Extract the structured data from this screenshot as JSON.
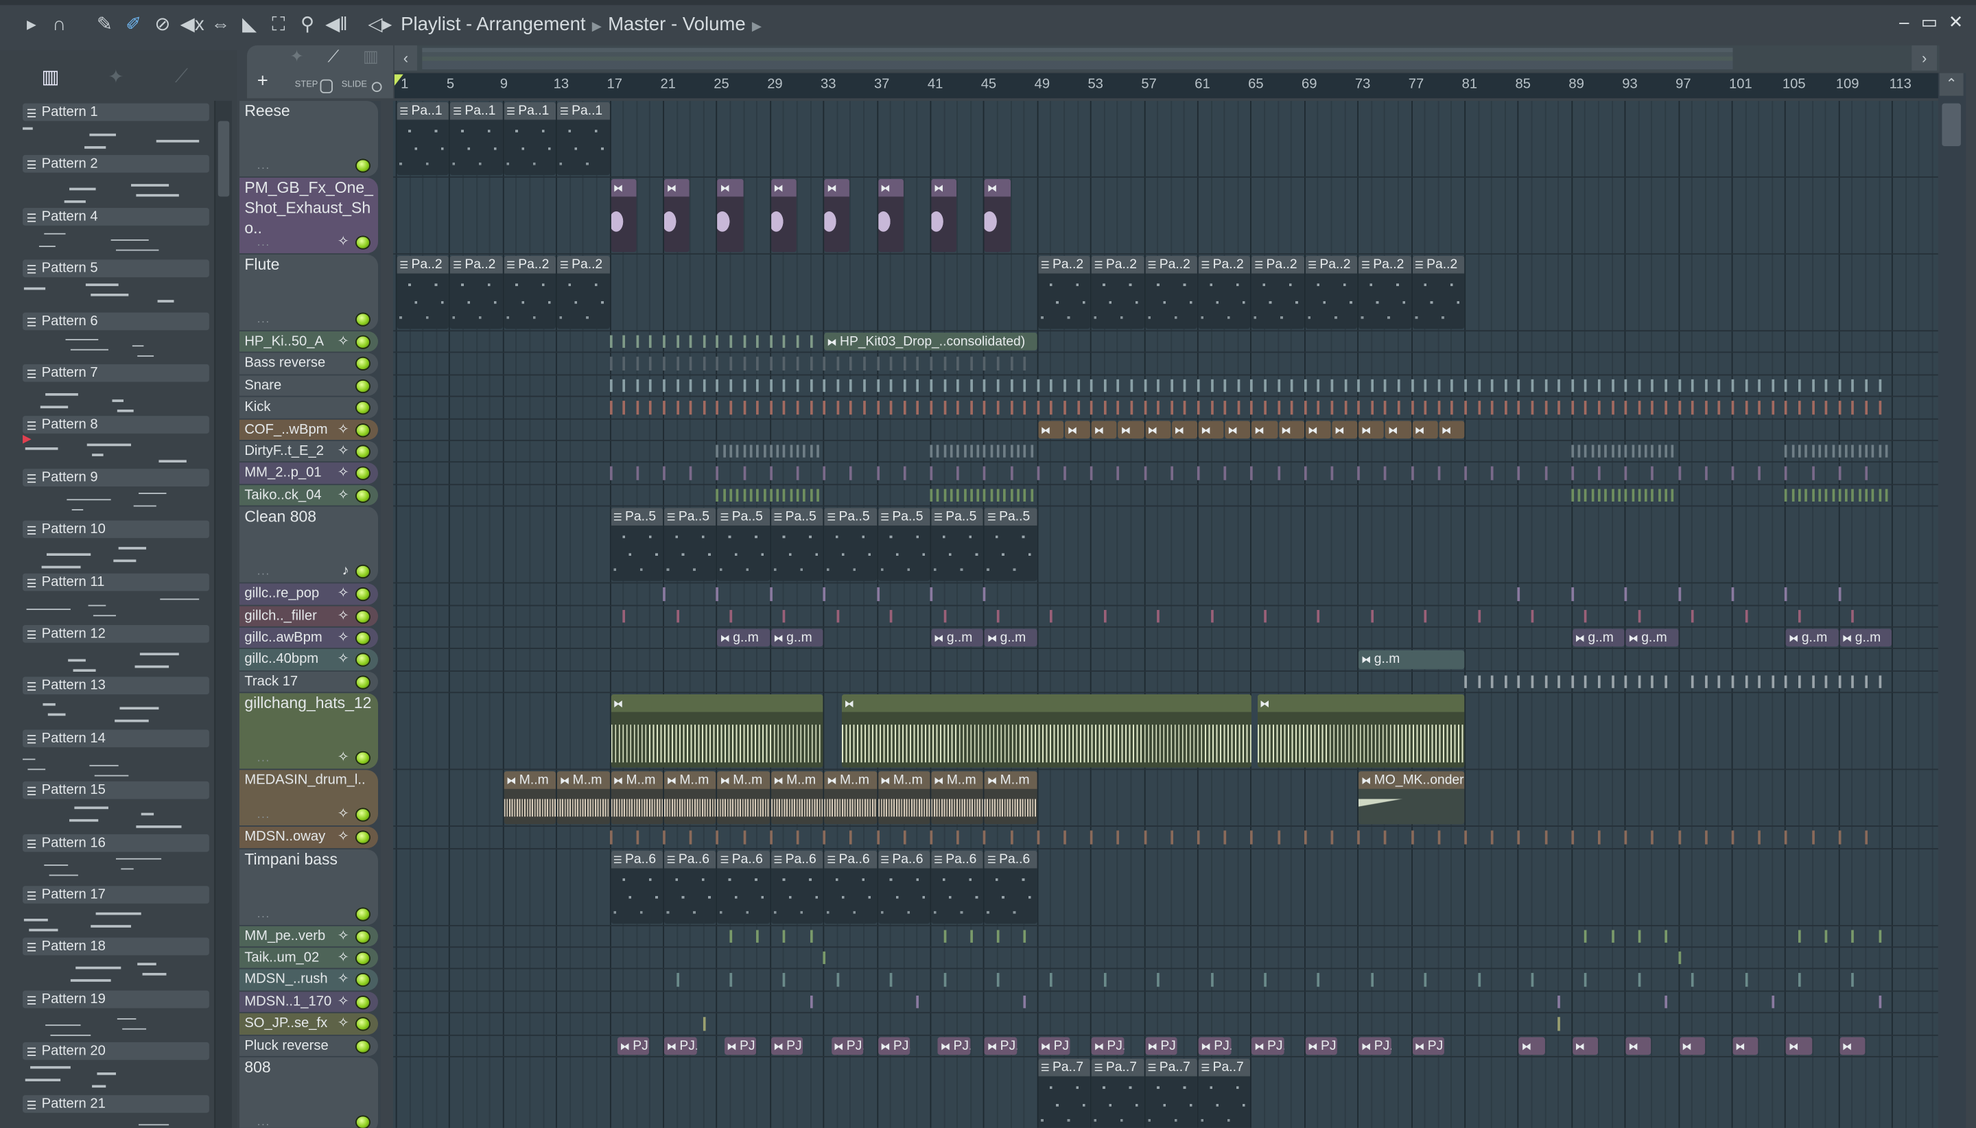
{
  "window": {
    "title": "Playlist - Arrangement",
    "breadcrumb": [
      "Playlist - Arrangement",
      "Master - Volume"
    ],
    "controls": {
      "minimize": "–",
      "maximize": "▭",
      "close": "✕"
    }
  },
  "toolbar": {
    "icons": [
      "play-arrow-icon",
      "magnet-icon",
      "pencil-icon",
      "paint-brush-icon",
      "delete-icon",
      "mute-icon",
      "slip-icon",
      "slice-icon",
      "select-icon",
      "zoom-icon",
      "playback-icon",
      "speaker-icon"
    ]
  },
  "playlist_tabs": {
    "add": "+",
    "step": "STEP",
    "slide": "SLIDE"
  },
  "ruler": {
    "bars": [
      1,
      5,
      9,
      13,
      17,
      21,
      25,
      29,
      33,
      37,
      41,
      45,
      49,
      53,
      57,
      61,
      65,
      69,
      73,
      77,
      81,
      85,
      89,
      93,
      97,
      101,
      105,
      109,
      113
    ]
  },
  "patterns": [
    "Pattern 1",
    "Pattern 2",
    "Pattern 4",
    "Pattern 5",
    "Pattern 6",
    "Pattern 7",
    "Pattern 8",
    "Pattern 9",
    "Pattern 10",
    "Pattern 11",
    "Pattern 12",
    "Pattern 13",
    "Pattern 14",
    "Pattern 15",
    "Pattern 16",
    "Pattern 17",
    "Pattern 18",
    "Pattern 19",
    "Pattern 20",
    "Pattern 21"
  ],
  "colors": {
    "default": "#4a535a",
    "purple": "#5e5270",
    "green": "#4e6458",
    "brown": "#6b5a47",
    "violet": "#534f68",
    "olive": "#596a4c",
    "rose": "#5f4a55",
    "teal": "#4a6062",
    "tan": "#6a5e4a",
    "khaki": "#5e6348"
  },
  "tracks": [
    {
      "name": "Reese",
      "size": "tall",
      "color": "default",
      "icon": "",
      "clips": [
        {
          "s": 1,
          "l": 4,
          "t": "Pa..1",
          "k": "p"
        },
        {
          "s": 5,
          "l": 4,
          "t": "Pa..1",
          "k": "p"
        },
        {
          "s": 9,
          "l": 4,
          "t": "Pa..1",
          "k": "p"
        },
        {
          "s": 13,
          "l": 4,
          "t": "Pa..1",
          "k": "p"
        }
      ]
    },
    {
      "name": "PM_GB_Fx_One_Shot_Exhaust_Sho..",
      "size": "tall",
      "color": "purple",
      "icon": "wave",
      "clips": [
        {
          "s": 17,
          "l": 2,
          "t": "",
          "k": "a"
        },
        {
          "s": 21,
          "l": 2,
          "t": "",
          "k": "a"
        },
        {
          "s": 25,
          "l": 2,
          "t": "",
          "k": "a"
        },
        {
          "s": 29,
          "l": 2,
          "t": "",
          "k": "a"
        },
        {
          "s": 33,
          "l": 2,
          "t": "",
          "k": "a"
        },
        {
          "s": 37,
          "l": 2,
          "t": "",
          "k": "a"
        },
        {
          "s": 41,
          "l": 2,
          "t": "",
          "k": "a"
        },
        {
          "s": 45,
          "l": 2,
          "t": "",
          "k": "a"
        }
      ]
    },
    {
      "name": "Flute",
      "size": "tall",
      "color": "default",
      "icon": "",
      "clips": [
        {
          "s": 1,
          "l": 4,
          "t": "Pa..2",
          "k": "p"
        },
        {
          "s": 5,
          "l": 4,
          "t": "Pa..2",
          "k": "p"
        },
        {
          "s": 9,
          "l": 4,
          "t": "Pa..2",
          "k": "p"
        },
        {
          "s": 13,
          "l": 4,
          "t": "Pa..2",
          "k": "p"
        },
        {
          "s": 49,
          "l": 4,
          "t": "Pa..2",
          "k": "p"
        },
        {
          "s": 53,
          "l": 4,
          "t": "Pa..2",
          "k": "p"
        },
        {
          "s": 57,
          "l": 4,
          "t": "Pa..2",
          "k": "p"
        },
        {
          "s": 61,
          "l": 4,
          "t": "Pa..2",
          "k": "p"
        },
        {
          "s": 65,
          "l": 4,
          "t": "Pa..2",
          "k": "p"
        },
        {
          "s": 69,
          "l": 4,
          "t": "Pa..2",
          "k": "p"
        },
        {
          "s": 73,
          "l": 4,
          "t": "Pa..2",
          "k": "p"
        },
        {
          "s": 77,
          "l": 4,
          "t": "Pa..2",
          "k": "p"
        }
      ]
    },
    {
      "name": "HP_Ki..50_A",
      "size": "small",
      "color": "green",
      "icon": "wave",
      "ticks": [
        [
          17,
          33,
          1,
          "#7f9a88"
        ]
      ],
      "clips": [
        {
          "s": 33,
          "l": 16,
          "t": "HP_Kit03_Drop_..consolidated)",
          "k": "a"
        }
      ]
    },
    {
      "name": "Bass reverse",
      "size": "small",
      "color": "default",
      "icon": "",
      "ticks": [
        [
          17,
          49,
          1,
          "#56626a"
        ]
      ]
    },
    {
      "name": "Snare",
      "size": "small",
      "color": "default",
      "icon": "",
      "ticks": [
        [
          17,
          113,
          1,
          "#8aa0a6"
        ]
      ]
    },
    {
      "name": "Kick",
      "size": "small",
      "color": "default",
      "icon": "",
      "ticks": [
        [
          17,
          113,
          1,
          "#a26a60"
        ]
      ]
    },
    {
      "name": "COF_..wBpm",
      "size": "small",
      "color": "brown",
      "icon": "wave",
      "clips": [
        {
          "s": 49,
          "l": 2,
          "t": "",
          "k": "a"
        },
        {
          "s": 51,
          "l": 2,
          "t": "",
          "k": "a"
        },
        {
          "s": 53,
          "l": 2,
          "t": "",
          "k": "a"
        },
        {
          "s": 55,
          "l": 2,
          "t": "",
          "k": "a"
        },
        {
          "s": 57,
          "l": 2,
          "t": "",
          "k": "a"
        },
        {
          "s": 59,
          "l": 2,
          "t": "",
          "k": "a"
        },
        {
          "s": 61,
          "l": 2,
          "t": "",
          "k": "a"
        },
        {
          "s": 63,
          "l": 2,
          "t": "",
          "k": "a"
        },
        {
          "s": 65,
          "l": 2,
          "t": "",
          "k": "a"
        },
        {
          "s": 67,
          "l": 2,
          "t": "",
          "k": "a"
        },
        {
          "s": 69,
          "l": 2,
          "t": "",
          "k": "a"
        },
        {
          "s": 71,
          "l": 2,
          "t": "",
          "k": "a"
        },
        {
          "s": 73,
          "l": 2,
          "t": "",
          "k": "a"
        },
        {
          "s": 75,
          "l": 2,
          "t": "",
          "k": "a"
        },
        {
          "s": 77,
          "l": 2,
          "t": "",
          "k": "a"
        },
        {
          "s": 79,
          "l": 2,
          "t": "",
          "k": "a"
        }
      ]
    },
    {
      "name": "DirtyF..t_E_2",
      "size": "small",
      "color": "default",
      "icon": "wave",
      "ticks": [
        [
          25,
          33,
          0.5,
          "#6f7e86"
        ],
        [
          41,
          49,
          0.5,
          "#6f7e86"
        ],
        [
          89,
          97,
          0.5,
          "#6f7e86"
        ],
        [
          105,
          113,
          0.5,
          "#6f7e86"
        ]
      ]
    },
    {
      "name": "MM_2..p_01",
      "size": "small",
      "color": "violet",
      "icon": "wave",
      "ticks": [
        [
          17,
          113,
          2,
          "#7a6a8a"
        ]
      ]
    },
    {
      "name": "Taiko..ck_04",
      "size": "small",
      "color": "green",
      "icon": "wave",
      "ticks": [
        [
          25,
          33,
          0.5,
          "#6f8f5f"
        ],
        [
          41,
          49,
          0.5,
          "#6f8f5f"
        ],
        [
          89,
          97,
          0.5,
          "#6f8f5f"
        ],
        [
          105,
          113,
          0.5,
          "#6f8f5f"
        ]
      ]
    },
    {
      "name": "Clean 808",
      "size": "tall",
      "color": "default",
      "icon": "note",
      "clips": [
        {
          "s": 17,
          "l": 4,
          "t": "Pa..5",
          "k": "p"
        },
        {
          "s": 21,
          "l": 4,
          "t": "Pa..5",
          "k": "p"
        },
        {
          "s": 25,
          "l": 4,
          "t": "Pa..5",
          "k": "p"
        },
        {
          "s": 29,
          "l": 4,
          "t": "Pa..5",
          "k": "p"
        },
        {
          "s": 33,
          "l": 4,
          "t": "Pa..5",
          "k": "p"
        },
        {
          "s": 37,
          "l": 4,
          "t": "Pa..5",
          "k": "p"
        },
        {
          "s": 41,
          "l": 4,
          "t": "Pa..5",
          "k": "p"
        },
        {
          "s": 45,
          "l": 4,
          "t": "Pa..5",
          "k": "p"
        }
      ]
    },
    {
      "name": "gillc..re_pop",
      "size": "small",
      "color": "violet",
      "icon": "wave",
      "ticks": [
        [
          21,
          49,
          4,
          "#8a7aa0"
        ],
        [
          85,
          113,
          4,
          "#8a7aa0"
        ]
      ]
    },
    {
      "name": "gillch.._filler",
      "size": "small",
      "color": "rose",
      "icon": "wave",
      "ticks": [
        [
          18,
          113,
          4,
          "#9a6078"
        ]
      ]
    },
    {
      "name": "gillc..awBpm",
      "size": "small",
      "color": "violet",
      "icon": "wave",
      "clips": [
        {
          "s": 25,
          "l": 4,
          "t": "g..m",
          "k": "a"
        },
        {
          "s": 29,
          "l": 4,
          "t": "g..m",
          "k": "a"
        },
        {
          "s": 41,
          "l": 4,
          "t": "g..m",
          "k": "a"
        },
        {
          "s": 45,
          "l": 4,
          "t": "g..m",
          "k": "a"
        },
        {
          "s": 89,
          "l": 4,
          "t": "g..m",
          "k": "a"
        },
        {
          "s": 93,
          "l": 4,
          "t": "g..m",
          "k": "a"
        },
        {
          "s": 105,
          "l": 4,
          "t": "g..m",
          "k": "a"
        },
        {
          "s": 109,
          "l": 4,
          "t": "g..m",
          "k": "a"
        }
      ]
    },
    {
      "name": "gillc..40bpm",
      "size": "small",
      "color": "teal",
      "icon": "wave",
      "clips": [
        {
          "s": 73,
          "l": 8,
          "t": "g..m",
          "k": "a"
        }
      ]
    },
    {
      "name": "Track 17",
      "size": "small",
      "color": "default",
      "icon": "",
      "ticks": [
        [
          81,
          97,
          1,
          "#9aa4aa"
        ],
        [
          98,
          113,
          1,
          "#9aa4aa"
        ]
      ]
    },
    {
      "name": "gillchang_hats_12",
      "size": "tall",
      "color": "olive",
      "icon": "wave",
      "clips": [
        {
          "s": 17,
          "l": 16,
          "t": "",
          "k": "w"
        },
        {
          "s": 34.3,
          "l": 30.8,
          "t": "",
          "k": "w"
        },
        {
          "s": 65.4,
          "l": 15.6,
          "t": "",
          "k": "w"
        }
      ]
    },
    {
      "name": "MEDASIN_drum_l..",
      "size": "medium",
      "color": "tan",
      "icon": "wave",
      "clips": [
        {
          "s": 9,
          "l": 4,
          "t": "M..m",
          "k": "m"
        },
        {
          "s": 13,
          "l": 4,
          "t": "M..m",
          "k": "m"
        },
        {
          "s": 17,
          "l": 4,
          "t": "M..m",
          "k": "m"
        },
        {
          "s": 21,
          "l": 4,
          "t": "M..m",
          "k": "m"
        },
        {
          "s": 25,
          "l": 4,
          "t": "M..m",
          "k": "m"
        },
        {
          "s": 29,
          "l": 4,
          "t": "M..m",
          "k": "m"
        },
        {
          "s": 33,
          "l": 4,
          "t": "M..m",
          "k": "m"
        },
        {
          "s": 37,
          "l": 4,
          "t": "M..m",
          "k": "m"
        },
        {
          "s": 41,
          "l": 4,
          "t": "M..m",
          "k": "m"
        },
        {
          "s": 45,
          "l": 4,
          "t": "M..m",
          "k": "m"
        },
        {
          "s": 73,
          "l": 8,
          "t": "MO_MK..onder",
          "k": "m"
        }
      ]
    },
    {
      "name": "MDSN..oway",
      "size": "small",
      "color": "brown",
      "icon": "wave",
      "ticks": [
        [
          17,
          113,
          2,
          "#8a6a5a"
        ]
      ]
    },
    {
      "name": "Timpani bass",
      "size": "tall",
      "color": "default",
      "icon": "",
      "clips": [
        {
          "s": 17,
          "l": 4,
          "t": "Pa..6",
          "k": "p"
        },
        {
          "s": 21,
          "l": 4,
          "t": "Pa..6",
          "k": "p"
        },
        {
          "s": 25,
          "l": 4,
          "t": "Pa..6",
          "k": "p"
        },
        {
          "s": 29,
          "l": 4,
          "t": "Pa..6",
          "k": "p"
        },
        {
          "s": 33,
          "l": 4,
          "t": "Pa..6",
          "k": "p"
        },
        {
          "s": 37,
          "l": 4,
          "t": "Pa..6",
          "k": "p"
        },
        {
          "s": 41,
          "l": 4,
          "t": "Pa..6",
          "k": "p"
        },
        {
          "s": 45,
          "l": 4,
          "t": "Pa..6",
          "k": "p"
        }
      ]
    },
    {
      "name": "MM_pe..verb",
      "size": "small",
      "color": "green",
      "icon": "wave",
      "ticks": [
        [
          26,
          33,
          2,
          "#7a9a6a"
        ],
        [
          42,
          49,
          2,
          "#7a9a6a"
        ],
        [
          90,
          97,
          2,
          "#7a9a6a"
        ],
        [
          106,
          113,
          2,
          "#7a9a6a"
        ]
      ]
    },
    {
      "name": "Taik..um_02",
      "size": "small",
      "color": "green",
      "icon": "wave",
      "ticks": [
        [
          33,
          34,
          4,
          "#7a9a6a"
        ],
        [
          97,
          98,
          4,
          "#7a9a6a"
        ]
      ]
    },
    {
      "name": "MDSN_..rush",
      "size": "small",
      "color": "teal",
      "icon": "wave",
      "ticks": [
        [
          22,
          113,
          4,
          "#6a8a8a"
        ]
      ]
    },
    {
      "name": "MDSN..1_170",
      "size": "small",
      "color": "violet",
      "icon": "wave",
      "ticks": [
        [
          32,
          49,
          8,
          "#8a7aa0"
        ],
        [
          88,
          113,
          8,
          "#8a7aa0"
        ]
      ]
    },
    {
      "name": "SO_JP..se_fx",
      "size": "small",
      "color": "khaki",
      "icon": "wave",
      "ticks": [
        [
          24,
          25,
          4,
          "#9aa070"
        ],
        [
          88,
          89,
          4,
          "#9aa070"
        ]
      ]
    },
    {
      "name": "Pluck reverse",
      "size": "small",
      "color": "default",
      "icon": "",
      "clips": [
        {
          "s": 17.5,
          "l": 2.5,
          "t": "PJ..)",
          "k": "v"
        },
        {
          "s": 21,
          "l": 2.5,
          "t": "PJ..)",
          "k": "v"
        },
        {
          "s": 25.5,
          "l": 2.5,
          "t": "PJ..)",
          "k": "v"
        },
        {
          "s": 29,
          "l": 2.5,
          "t": "PJ..)",
          "k": "v"
        },
        {
          "s": 33.5,
          "l": 2.5,
          "t": "PJ..)",
          "k": "v"
        },
        {
          "s": 37,
          "l": 2.5,
          "t": "PJ..)",
          "k": "v"
        },
        {
          "s": 41.5,
          "l": 2.5,
          "t": "PJ..)",
          "k": "v"
        },
        {
          "s": 45,
          "l": 2.5,
          "t": "PJ..)",
          "k": "v"
        },
        {
          "s": 49,
          "l": 2.5,
          "t": "PJ..)",
          "k": "v"
        },
        {
          "s": 53,
          "l": 2.5,
          "t": "PJ..)",
          "k": "v"
        },
        {
          "s": 57,
          "l": 2.5,
          "t": "PJ..)",
          "k": "v"
        },
        {
          "s": 61,
          "l": 2.5,
          "t": "PJ..)",
          "k": "v"
        },
        {
          "s": 65,
          "l": 2.5,
          "t": "PJ..)",
          "k": "v"
        },
        {
          "s": 69,
          "l": 2.5,
          "t": "PJ..)",
          "k": "v"
        },
        {
          "s": 73,
          "l": 2.5,
          "t": "PJ..)",
          "k": "v"
        },
        {
          "s": 77,
          "l": 2.5,
          "t": "PJ..)",
          "k": "v"
        },
        {
          "s": 85,
          "l": 2,
          "t": "",
          "k": "v"
        },
        {
          "s": 89,
          "l": 2,
          "t": "",
          "k": "v"
        },
        {
          "s": 93,
          "l": 2,
          "t": "",
          "k": "v"
        },
        {
          "s": 97,
          "l": 2,
          "t": "",
          "k": "v"
        },
        {
          "s": 101,
          "l": 2,
          "t": "",
          "k": "v"
        },
        {
          "s": 105,
          "l": 2,
          "t": "",
          "k": "v"
        },
        {
          "s": 109,
          "l": 2,
          "t": "",
          "k": "v"
        }
      ]
    },
    {
      "name": "808",
      "size": "tall",
      "color": "default",
      "icon": "",
      "clips": [
        {
          "s": 49,
          "l": 4,
          "t": "Pa..7",
          "k": "p"
        },
        {
          "s": 53,
          "l": 4,
          "t": "Pa..7",
          "k": "p"
        },
        {
          "s": 57,
          "l": 4,
          "t": "Pa..7",
          "k": "p"
        },
        {
          "s": 61,
          "l": 4,
          "t": "Pa..7",
          "k": "p"
        }
      ]
    }
  ]
}
